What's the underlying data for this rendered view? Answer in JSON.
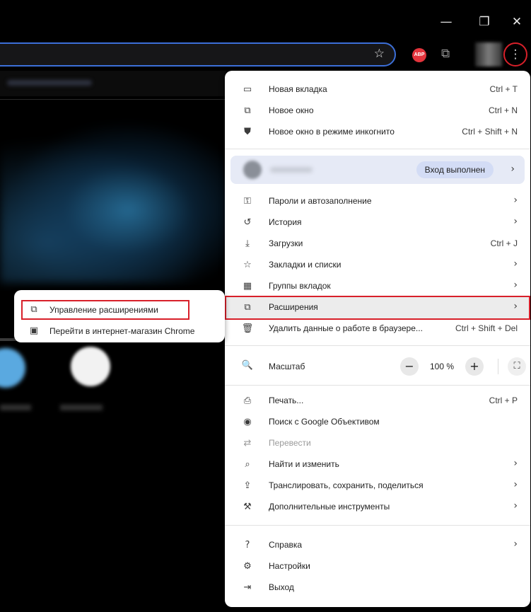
{
  "window": {
    "minimize": "—",
    "restore": "❐",
    "close": "✕"
  },
  "toolbar": {
    "bookmark_star": "☆",
    "abp_label": "ABP",
    "extensions_icon": "⧉",
    "menu_icon": "⋮"
  },
  "menu": {
    "items_top": [
      {
        "icon": "▭",
        "label": "Новая вкладка",
        "shortcut": "Ctrl + T"
      },
      {
        "icon": "⧉",
        "label": "Новое окно",
        "shortcut": "Ctrl + N"
      },
      {
        "icon": "⛊",
        "label": "Новое окно в режиме инкогнито",
        "shortcut": "Ctrl + Shift + N"
      }
    ],
    "profile": {
      "status": "Вход выполнен",
      "arrow": "›"
    },
    "items_mid": [
      {
        "icon": "⚿",
        "label": "Пароли и автозаполнение",
        "arrow": "›"
      },
      {
        "icon": "↺",
        "label": "История",
        "arrow": "›"
      },
      {
        "icon": "⤓",
        "label": "Загрузки",
        "shortcut": "Ctrl + J"
      },
      {
        "icon": "☆",
        "label": "Закладки и списки",
        "arrow": "›"
      },
      {
        "icon": "▦",
        "label": "Группы вкладок",
        "arrow": "›"
      },
      {
        "icon": "⧉",
        "label": "Расширения",
        "arrow": "›"
      },
      {
        "icon": "🗑",
        "label": "Удалить данные о работе в браузере...",
        "shortcut": "Ctrl + Shift + Del"
      }
    ],
    "zoom": {
      "icon": "🔍",
      "label": "Масштаб",
      "minus": "−",
      "value": "100 %",
      "plus": "+",
      "fullscreen": "⛶"
    },
    "items_tools": [
      {
        "icon": "⎙",
        "label": "Печать...",
        "shortcut": "Ctrl + P"
      },
      {
        "icon": "◉",
        "label": "Поиск с Google Объективом"
      },
      {
        "icon": "⇄",
        "label": "Перевести"
      },
      {
        "icon": "⌕",
        "label": "Найти и изменить",
        "arrow": "›"
      },
      {
        "icon": "⇪",
        "label": "Транслировать, сохранить, поделиться",
        "arrow": "›"
      },
      {
        "icon": "⚒",
        "label": "Дополнительные инструменты",
        "arrow": "›"
      }
    ],
    "items_bottom": [
      {
        "icon": "?",
        "label": "Справка",
        "arrow": "›"
      },
      {
        "icon": "⚙",
        "label": "Настройки"
      },
      {
        "icon": "⇥",
        "label": "Выход"
      }
    ]
  },
  "submenu": {
    "items": [
      {
        "icon": "⧉",
        "label": "Управление расширениями"
      },
      {
        "icon": "▣",
        "label": "Перейти в интернет-магазин Chrome"
      }
    ]
  },
  "colors": {
    "annotation_red": "#d8202a",
    "accent_blue": "#3c6fd8",
    "signin_bg": "#e6eaf6"
  }
}
